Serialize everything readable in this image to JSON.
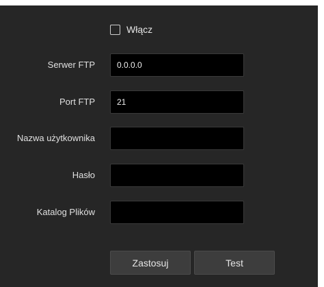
{
  "enable": {
    "label": "Włącz",
    "checked": false
  },
  "fields": [
    {
      "label": "Serwer FTP",
      "value": "0.0.0.0",
      "placeholder": ""
    },
    {
      "label": "Port FTP",
      "value": "21",
      "placeholder": ""
    },
    {
      "label": "Nazwa użytkownika",
      "value": "",
      "placeholder": ""
    },
    {
      "label": "Hasło",
      "value": "",
      "placeholder": ""
    },
    {
      "label": "Katalog Plików",
      "value": "",
      "placeholder": ""
    }
  ],
  "buttons": {
    "apply_label": "Zastosuj",
    "test_label": "Test"
  }
}
